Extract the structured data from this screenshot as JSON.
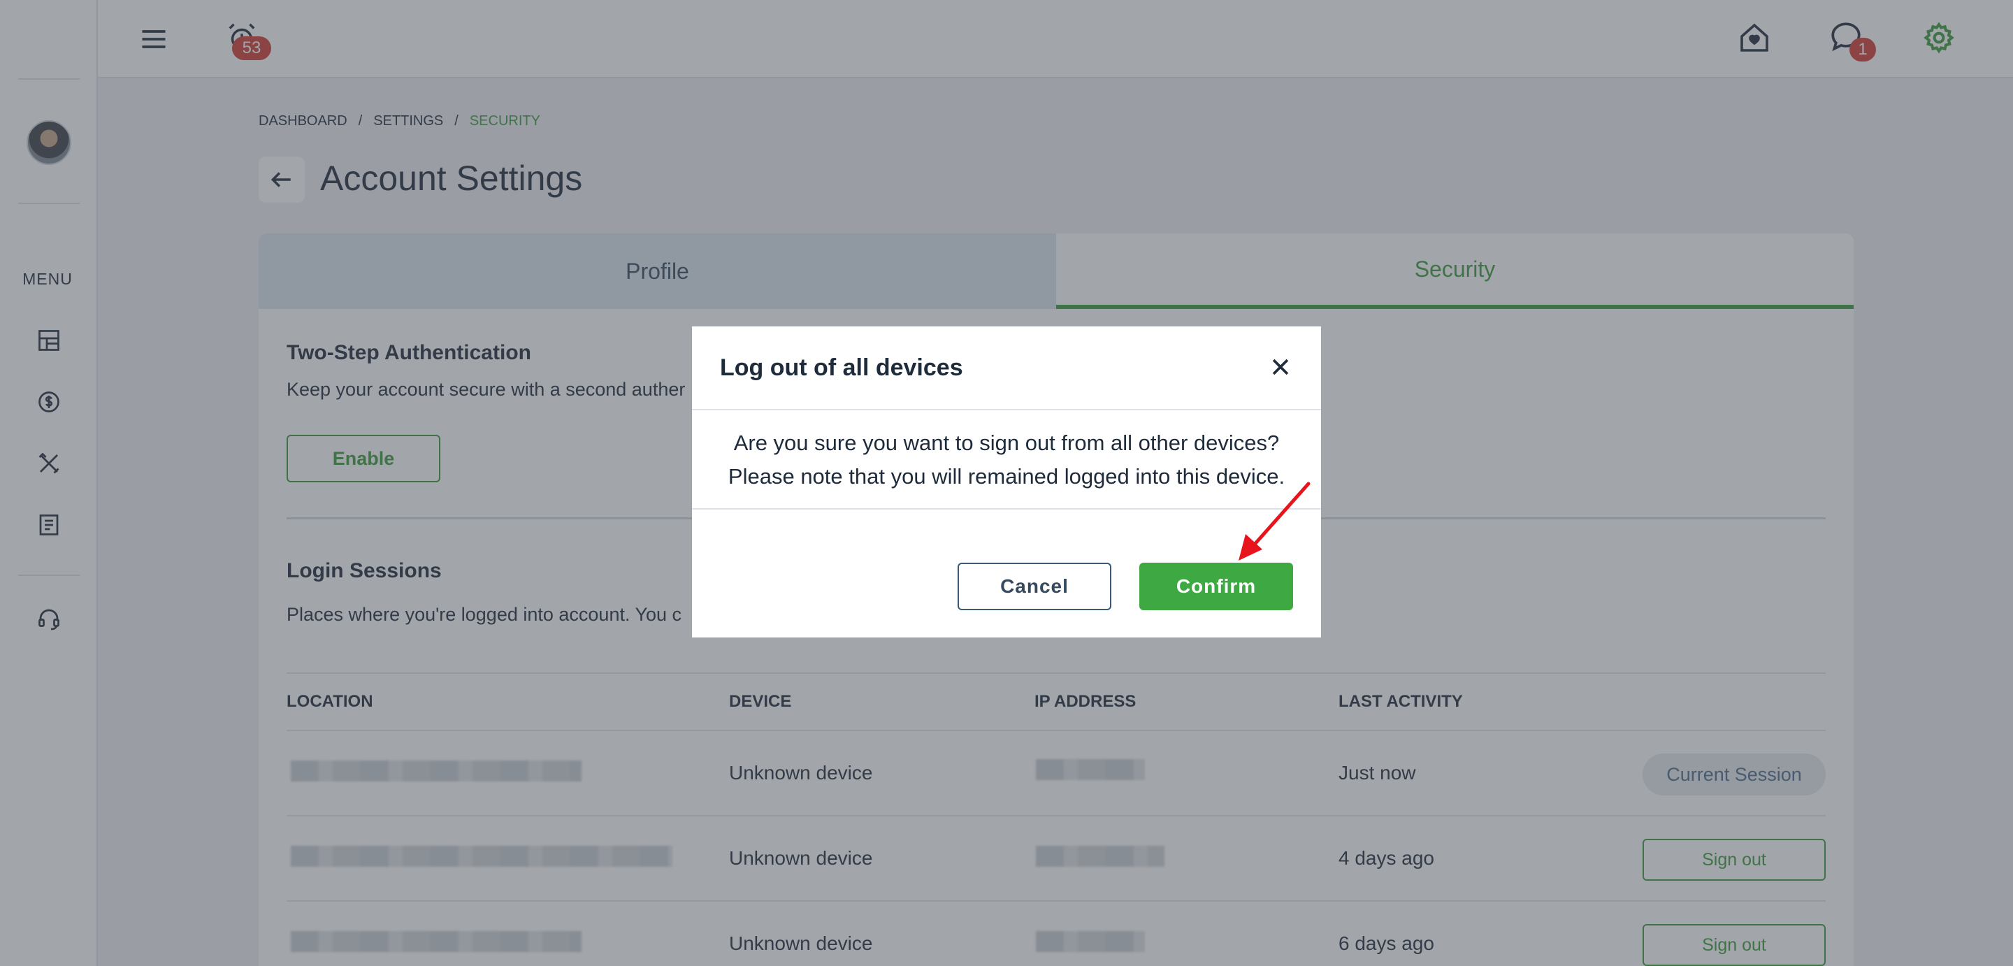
{
  "colors": {
    "accent_green": "#3a9a3c",
    "badge_red": "#d03a32",
    "text_dark": "#1e2b3a",
    "annotation_red": "#e8141c"
  },
  "sidebar": {
    "menu_label": "MENU",
    "icons": [
      "dashboard-icon",
      "dollar-icon",
      "tools-icon",
      "document-icon",
      "headset-icon"
    ]
  },
  "topbar": {
    "hamburger_icon": "hamburger-icon",
    "alarm_icon": "alarm-icon",
    "alarm_count": "53",
    "home_icon": "home-icon",
    "chat_icon": "chat-icon",
    "chat_count": "1",
    "settings_icon": "gear-icon"
  },
  "breadcrumb": {
    "items": [
      "DASHBOARD",
      "SETTINGS",
      "SECURITY"
    ],
    "separator": "/"
  },
  "page": {
    "title": "Account Settings"
  },
  "tabs": [
    {
      "label": "Profile",
      "active": false
    },
    {
      "label": "Security",
      "active": true
    }
  ],
  "two_step": {
    "title": "Two-Step Authentication",
    "description": "Keep your account secure with a second auther",
    "enable_label": "Enable"
  },
  "login_sessions": {
    "title": "Login Sessions",
    "description": "Places where you're logged into account. You c",
    "columns": [
      "LOCATION",
      "DEVICE",
      "IP ADDRESS",
      "LAST ACTIVITY"
    ],
    "rows": [
      {
        "device": "Unknown device",
        "last_activity": "Just now",
        "action": "Current Session"
      },
      {
        "device": "Unknown device",
        "last_activity": "4 days ago",
        "action": "Sign out"
      },
      {
        "device": "Unknown device",
        "last_activity": "6 days ago",
        "action": "Sign out"
      }
    ]
  },
  "modal": {
    "title": "Log out of all devices",
    "body_line1": "Are you sure you want to sign out from all other devices?",
    "body_line2": "Please note that you will remained logged into this device.",
    "cancel_label": "Cancel",
    "confirm_label": "Confirm"
  }
}
